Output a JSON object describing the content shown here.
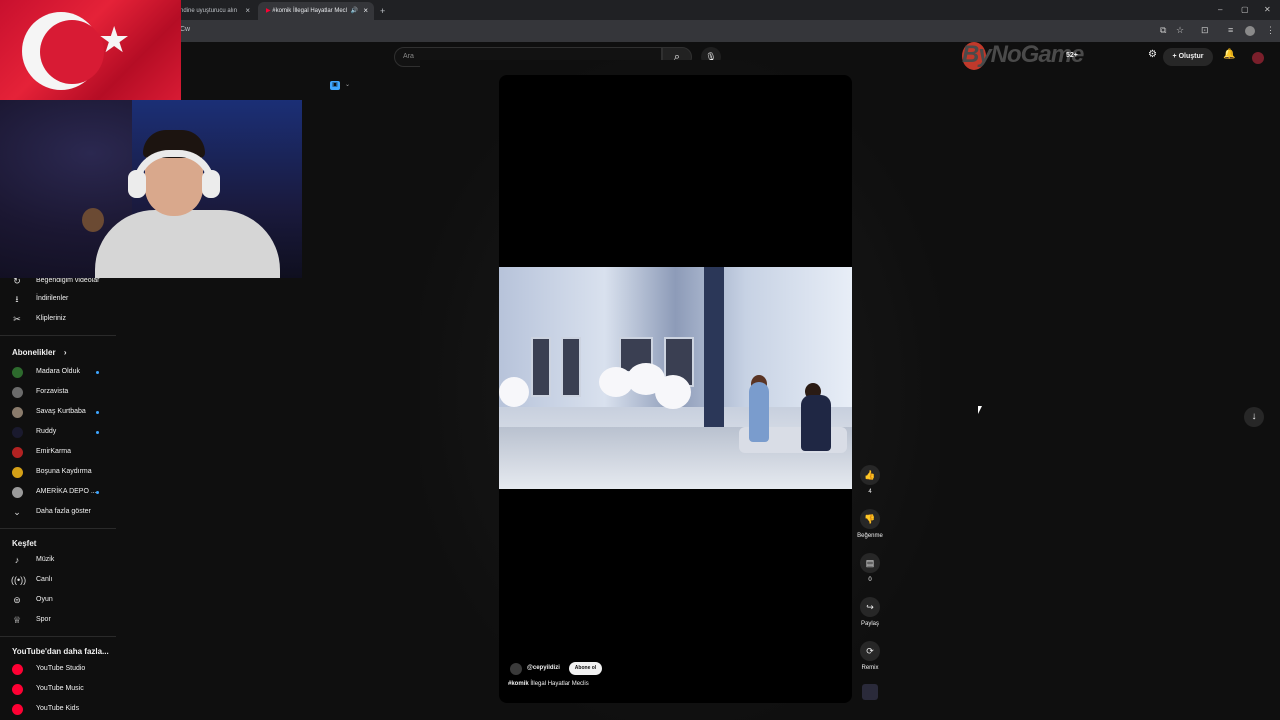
{
  "browser": {
    "tabs": [
      {
        "label": "ndine uyuşturucu alın",
        "close": "×"
      },
      {
        "label": "#komik İllegal Hayatlar Mecl",
        "close": "×"
      }
    ],
    "new_tab": "+",
    "address_text": "Cw",
    "window_controls": {
      "minimize": "–",
      "maximize": "▢",
      "close": "✕"
    }
  },
  "header": {
    "search_placeholder": "Ara",
    "brand_watermark": "ByNoGame",
    "counter": "52+",
    "create_label": "Oluştur"
  },
  "sidebar": {
    "library_items": [
      {
        "label": "Beğendiğim videolar",
        "icon": "like-icon"
      },
      {
        "label": "İndirilenler",
        "icon": "download-icon"
      },
      {
        "label": "Klipleriniz",
        "icon": "scissors-icon"
      }
    ],
    "subscriptions_heading": "Abonelikler",
    "subscriptions": [
      {
        "label": "Madara Olduk",
        "dot": true,
        "color": "#2d6a2d"
      },
      {
        "label": "Forzavista",
        "dot": false,
        "color": "#6b6b6b"
      },
      {
        "label": "Savaş Kurtbaba",
        "dot": true,
        "color": "#8a7b6c"
      },
      {
        "label": "Ruddy",
        "dot": true,
        "color": "#1a1a2e"
      },
      {
        "label": "EmirKarma",
        "dot": false,
        "color": "#b22222"
      },
      {
        "label": "Boşuna Kaydırma",
        "dot": false,
        "color": "#d4a017"
      },
      {
        "label": "AMERİKA DEPO ...",
        "dot": true,
        "color": "#9a9a9a"
      }
    ],
    "show_more": "Daha fazla göster",
    "explore_heading": "Keşfet",
    "explore": [
      {
        "label": "Müzik",
        "icon": "music-note-icon"
      },
      {
        "label": "Canlı",
        "icon": "live-icon"
      },
      {
        "label": "Oyun",
        "icon": "gamepad-icon"
      },
      {
        "label": "Spor",
        "icon": "trophy-icon"
      }
    ],
    "more_heading": "YouTube'dan daha fazla...",
    "more": [
      {
        "label": "YouTube Studio"
      },
      {
        "label": "YouTube Music"
      },
      {
        "label": "YouTube Kids"
      }
    ]
  },
  "short": {
    "channel": "@cepyildizi",
    "subscribe": "Abone ol",
    "hashtag": "#komik",
    "title": " İllegal Hayatlar Meclis",
    "actions": {
      "likes": "4",
      "dislike_label": "Beğenme",
      "comments": "0",
      "share_label": "Paylaş",
      "remix_label": "Remix"
    }
  },
  "colors": {
    "background": "#0f0f0f",
    "accent_blue": "#3ea6ff",
    "youtube_red": "#ff0033"
  }
}
